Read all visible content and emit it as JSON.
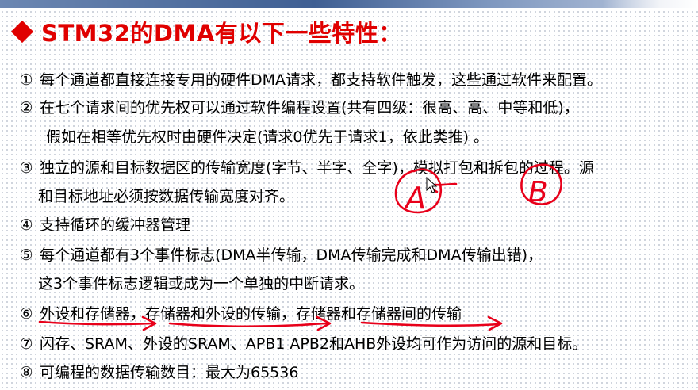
{
  "title": "STM32的DMA有以下一些特性：",
  "items": [
    {
      "num": "①",
      "text": "每个通道都直接连接专用的硬件DMA请求，都支持软件触发，这些通过软件来配置。"
    },
    {
      "num": "②",
      "text": "在七个请求间的优先权可以通过软件编程设置(共有四级：很高、高、中等和低)，",
      "cont": "假如在相等优先权时由硬件决定(请求0优先于请求1，依此类推) 。"
    },
    {
      "num": "③",
      "text": "独立的源和目标数据区的传输宽度(字节、半字、全字)，模拟打包和拆包的过程。源",
      "cont": "和目标地址必须按数据传输宽度对齐。"
    },
    {
      "num": "④",
      "text": "支持循环的缓冲器管理"
    },
    {
      "num": "⑤",
      "text": "每个通道都有3个事件标志(DMA半传输，DMA传输完成和DMA传输出错)，",
      "cont": "这3个事件标志逻辑或成为一个单独的中断请求。"
    },
    {
      "num": "⑥",
      "text": "外设和存储器，存储器和外设的传输，存储器和存储器间的传输"
    },
    {
      "num": "⑦",
      "text": "闪存、SRAM、外设的SRAM、APB1 APB2和AHB外设均可作为访问的源和目标。"
    },
    {
      "num": "⑧",
      "text": "可编程的数据传输数目：最大为65536"
    }
  ],
  "annotations": {
    "label_a": "A",
    "label_b": "B",
    "color": "#e8001a"
  },
  "colors": {
    "title": "#e00000",
    "text": "#000000",
    "top_bar": "#3f5f93"
  }
}
